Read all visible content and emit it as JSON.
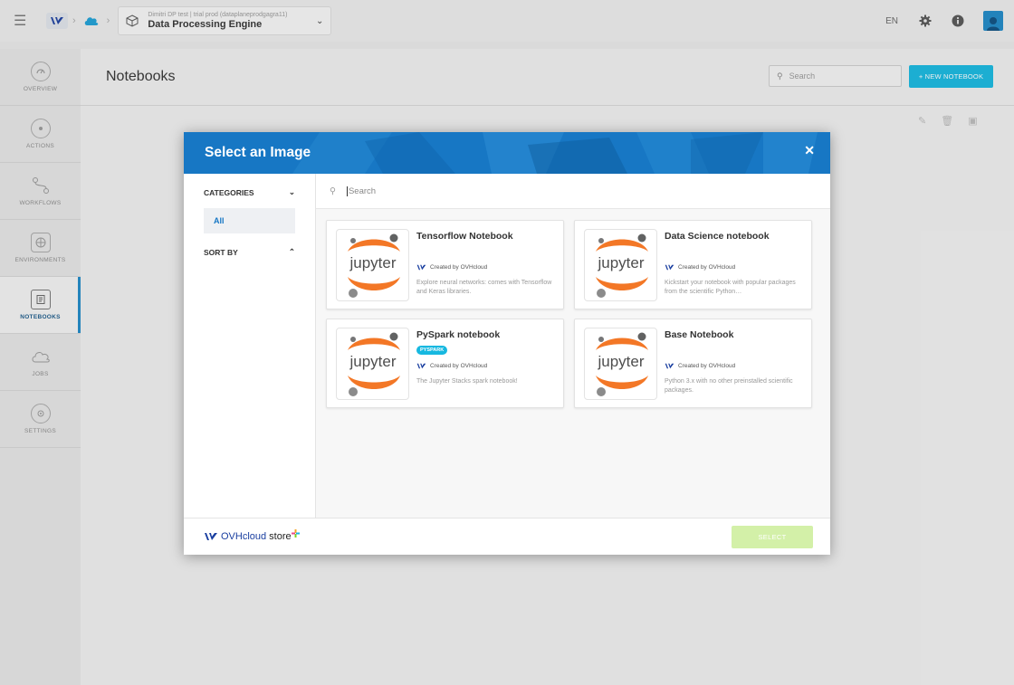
{
  "topbar": {
    "project_subtitle": "Dimitri DP test | trial prod (dataplaneprodgagra11)",
    "project_name": "Data Processing Engine",
    "language": "EN"
  },
  "sidebar": {
    "items": [
      {
        "label": "OVERVIEW",
        "icon": "gauge-icon",
        "active": false
      },
      {
        "label": "ACTIONS",
        "icon": "actions-icon",
        "active": false
      },
      {
        "label": "WORKFLOWS",
        "icon": "workflow-icon",
        "active": false
      },
      {
        "label": "ENVIRONMENTS",
        "icon": "environment-icon",
        "active": false
      },
      {
        "label": "NOTEBOOKS",
        "icon": "notebook-icon",
        "active": true
      },
      {
        "label": "JOBS",
        "icon": "cloud-jobs-icon",
        "active": false
      },
      {
        "label": "SETTINGS",
        "icon": "settings-icon",
        "active": false
      }
    ]
  },
  "page": {
    "title": "Notebooks",
    "search_placeholder": "Search",
    "new_button": "+ NEW NOTEBOOK"
  },
  "modal": {
    "title": "Select an Image",
    "categories_label": "CATEGORIES",
    "category_selected": "All",
    "sort_label": "SORT BY",
    "search_placeholder": "Search",
    "cards": [
      {
        "title": "Tensorflow Notebook",
        "badge": "",
        "creator": "Created by OVHcloud",
        "description": "Explore neural networks: comes with Tensorflow and Keras libraries."
      },
      {
        "title": "Data Science notebook",
        "badge": "",
        "creator": "Created by OVHcloud",
        "description": "Kickstart your notebook with popular packages from the scientific Python…"
      },
      {
        "title": "PySpark notebook",
        "badge": "PYSPARK",
        "creator": "Created by OVHcloud",
        "description": "The Jupyter Stacks spark notebook!"
      },
      {
        "title": "Base Notebook",
        "badge": "",
        "creator": "Created by OVHcloud",
        "description": "Python 3.x with no other preinstalled scientific packages."
      }
    ],
    "image_logo_text": "jupyter",
    "store_brand": "OVHcloud",
    "store_word": "store",
    "select_button": "SELECT"
  },
  "colors": {
    "accent": "#1777c4",
    "cyan": "#16b8e0",
    "jupyter_orange": "#f37726",
    "select_disabled": "#d3f0a8"
  }
}
